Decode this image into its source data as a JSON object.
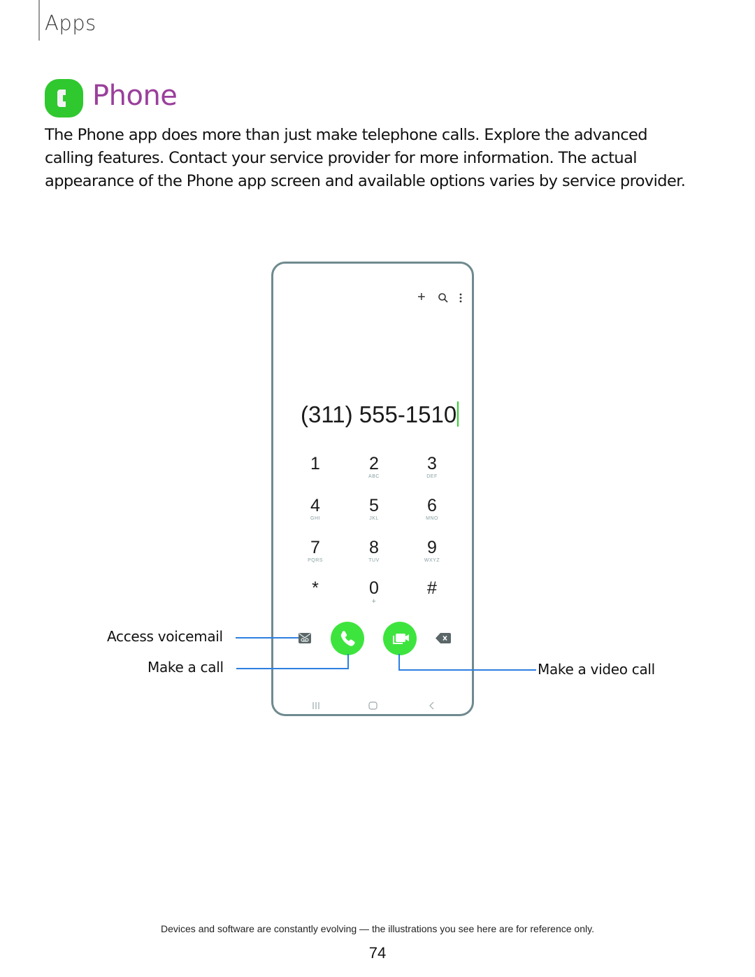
{
  "header": {
    "section": "Apps"
  },
  "title": {
    "text": "Phone",
    "icon": "phone-app-icon",
    "title_color": "#9a3f9b",
    "icon_color": "#2fc82f"
  },
  "intro": {
    "text": "The Phone app does more than just make telephone calls. Explore the advanced calling features. Contact your service provider for more information. The actual appearance of the Phone app screen and available options varies by service provider."
  },
  "phone_screen": {
    "top_icons": [
      "plus-icon",
      "search-icon",
      "more-options-icon"
    ],
    "dialed_number": "(311) 555-1510",
    "keypad": [
      {
        "digit": "1",
        "letters": ""
      },
      {
        "digit": "2",
        "letters": "ABC"
      },
      {
        "digit": "3",
        "letters": "DEF"
      },
      {
        "digit": "4",
        "letters": "GHI"
      },
      {
        "digit": "5",
        "letters": "JKL"
      },
      {
        "digit": "6",
        "letters": "MNO"
      },
      {
        "digit": "7",
        "letters": "PQRS"
      },
      {
        "digit": "8",
        "letters": "TUV"
      },
      {
        "digit": "9",
        "letters": "WXYZ"
      },
      {
        "digit": "*",
        "letters": ""
      },
      {
        "digit": "0",
        "letters": "+"
      },
      {
        "digit": "#",
        "letters": ""
      }
    ],
    "action_icons": [
      "voicemail-icon",
      "call-icon",
      "video-call-icon",
      "backspace-icon"
    ],
    "nav_icons": [
      "recent-apps-icon",
      "home-icon",
      "back-icon"
    ],
    "button_color": "#3ee43e"
  },
  "callouts": {
    "voicemail": "Access voicemail",
    "call": "Make a call",
    "video_call": "Make a video call",
    "line_color": "#2d7fe0"
  },
  "footer": {
    "note": "Devices and software are constantly evolving — the illustrations you see here are for reference only.",
    "page_number": "74"
  }
}
